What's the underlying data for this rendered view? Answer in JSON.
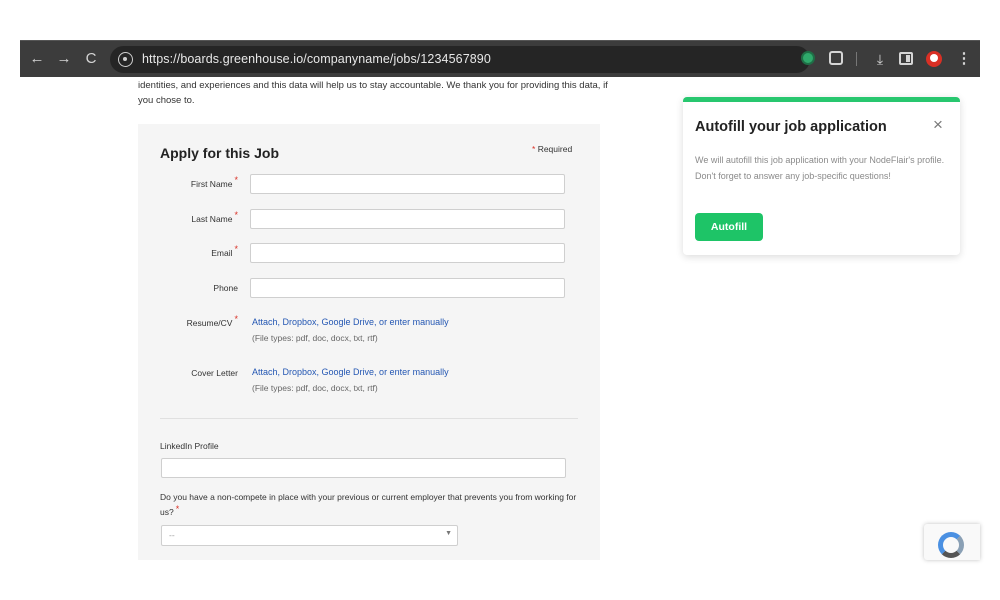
{
  "browser": {
    "url": "https://boards.greenhouse.io/companyname/jobs/1234567890",
    "back_icon": "←",
    "forward_icon": "→",
    "reload_icon": "C",
    "download_icon": "⤓",
    "menu_icon": "⋮"
  },
  "intro_text": "identities, and experiences and this data will help us to stay accountable. We thank you for providing this data, if you chose to.",
  "form": {
    "title": "Apply for this Job",
    "required_asterisk": "*",
    "required_note": "Required",
    "fields": {
      "first_name": "First Name",
      "last_name": "Last Name",
      "email": "Email",
      "phone": "Phone",
      "resume": "Resume/CV",
      "cover_letter": "Cover Letter"
    },
    "upload_links": "Attach, Dropbox, Google Drive, or enter manually",
    "file_types": "(File types: pdf, doc, docx, txt, rtf)",
    "linkedin_label": "LinkedIn Profile",
    "noncompete_question": "Do you have a non-compete in place with your previous or current employer that prevents you from working for us?",
    "select_value": "--",
    "select_arrow": "▼"
  },
  "popup": {
    "title": "Autofill your job application",
    "close_icon": "×",
    "body": "We will autofill this job application with your NodeFlair's profile. Don't forget to answer any job-specific questions!",
    "button_label": "Autofill",
    "accent_color": "#28c76f"
  },
  "colors": {
    "link": "#2457b3",
    "required": "#d93025",
    "browser_bar": "#3c3c3c"
  }
}
